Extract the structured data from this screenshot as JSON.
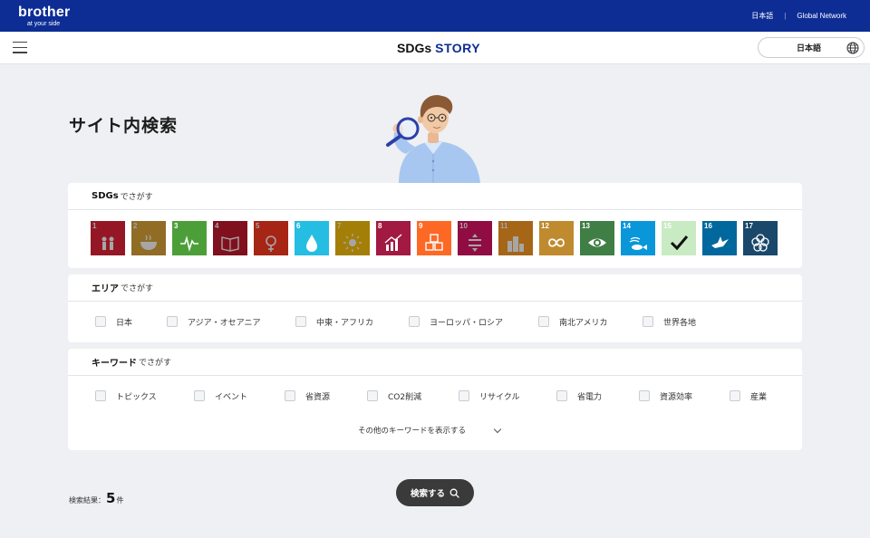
{
  "topbar": {
    "logo": "brother",
    "tagline": "at your side",
    "links": [
      "日本語",
      "Global Network"
    ]
  },
  "header": {
    "brand_prefix": "SDGs",
    "brand_suffix": "STORY",
    "language_selected": "日本語"
  },
  "page": {
    "title": "サイト内検索"
  },
  "sdg_section": {
    "title_bold": "SDGs",
    "title_suffix": "でさがす",
    "goals": [
      {
        "num": "1",
        "color": "#e5243b",
        "icon": "people-icon",
        "active": false
      },
      {
        "num": "2",
        "color": "#dda63a",
        "icon": "bowl-icon",
        "active": false
      },
      {
        "num": "3",
        "color": "#4c9f38",
        "icon": "heartbeat-icon",
        "active": true
      },
      {
        "num": "4",
        "color": "#c5192d",
        "icon": "book-icon",
        "active": false
      },
      {
        "num": "5",
        "color": "#ff3a21",
        "icon": "gender-icon",
        "active": false
      },
      {
        "num": "6",
        "color": "#26bde2",
        "icon": "water-drop-icon",
        "active": true
      },
      {
        "num": "7",
        "color": "#fcc30b",
        "icon": "sun-icon",
        "active": false
      },
      {
        "num": "8",
        "color": "#a21942",
        "icon": "growth-chart-icon",
        "active": true
      },
      {
        "num": "9",
        "color": "#fd6925",
        "icon": "cubes-icon",
        "active": true
      },
      {
        "num": "10",
        "color": "#dd1367",
        "icon": "equality-icon",
        "active": false
      },
      {
        "num": "11",
        "color": "#fd9d24",
        "icon": "buildings-icon",
        "active": false
      },
      {
        "num": "12",
        "color": "#bf8b2e",
        "icon": "infinity-icon",
        "active": true
      },
      {
        "num": "13",
        "color": "#3f7e44",
        "icon": "eye-globe-icon",
        "active": true
      },
      {
        "num": "14",
        "color": "#0a97d9",
        "icon": "fish-icon",
        "active": true
      },
      {
        "num": "15",
        "color": "#56c02b",
        "icon": "checkmark-icon",
        "active": true,
        "highlight": true
      },
      {
        "num": "16",
        "color": "#00689d",
        "icon": "dove-icon",
        "active": true
      },
      {
        "num": "17",
        "color": "#19486a",
        "icon": "flower-icon",
        "active": true,
        "dark": true
      }
    ]
  },
  "area_section": {
    "title_bold": "エリア",
    "title_suffix": "でさがす",
    "options": [
      "日本",
      "アジア・オセアニア",
      "中東・アフリカ",
      "ヨーロッパ・ロシア",
      "南北アメリカ",
      "世界各地"
    ]
  },
  "keyword_section": {
    "title_bold": "キーワード",
    "title_suffix": "でさがす",
    "options": [
      "トピックス",
      "イベント",
      "省資源",
      "CO2削減",
      "リサイクル",
      "省電力",
      "資源効率",
      "産業"
    ],
    "more_label": "その他のキーワードを表示する"
  },
  "results": {
    "label": "検索結果：",
    "count": "5",
    "unit": "件"
  },
  "search_button": {
    "label": "検索する"
  }
}
